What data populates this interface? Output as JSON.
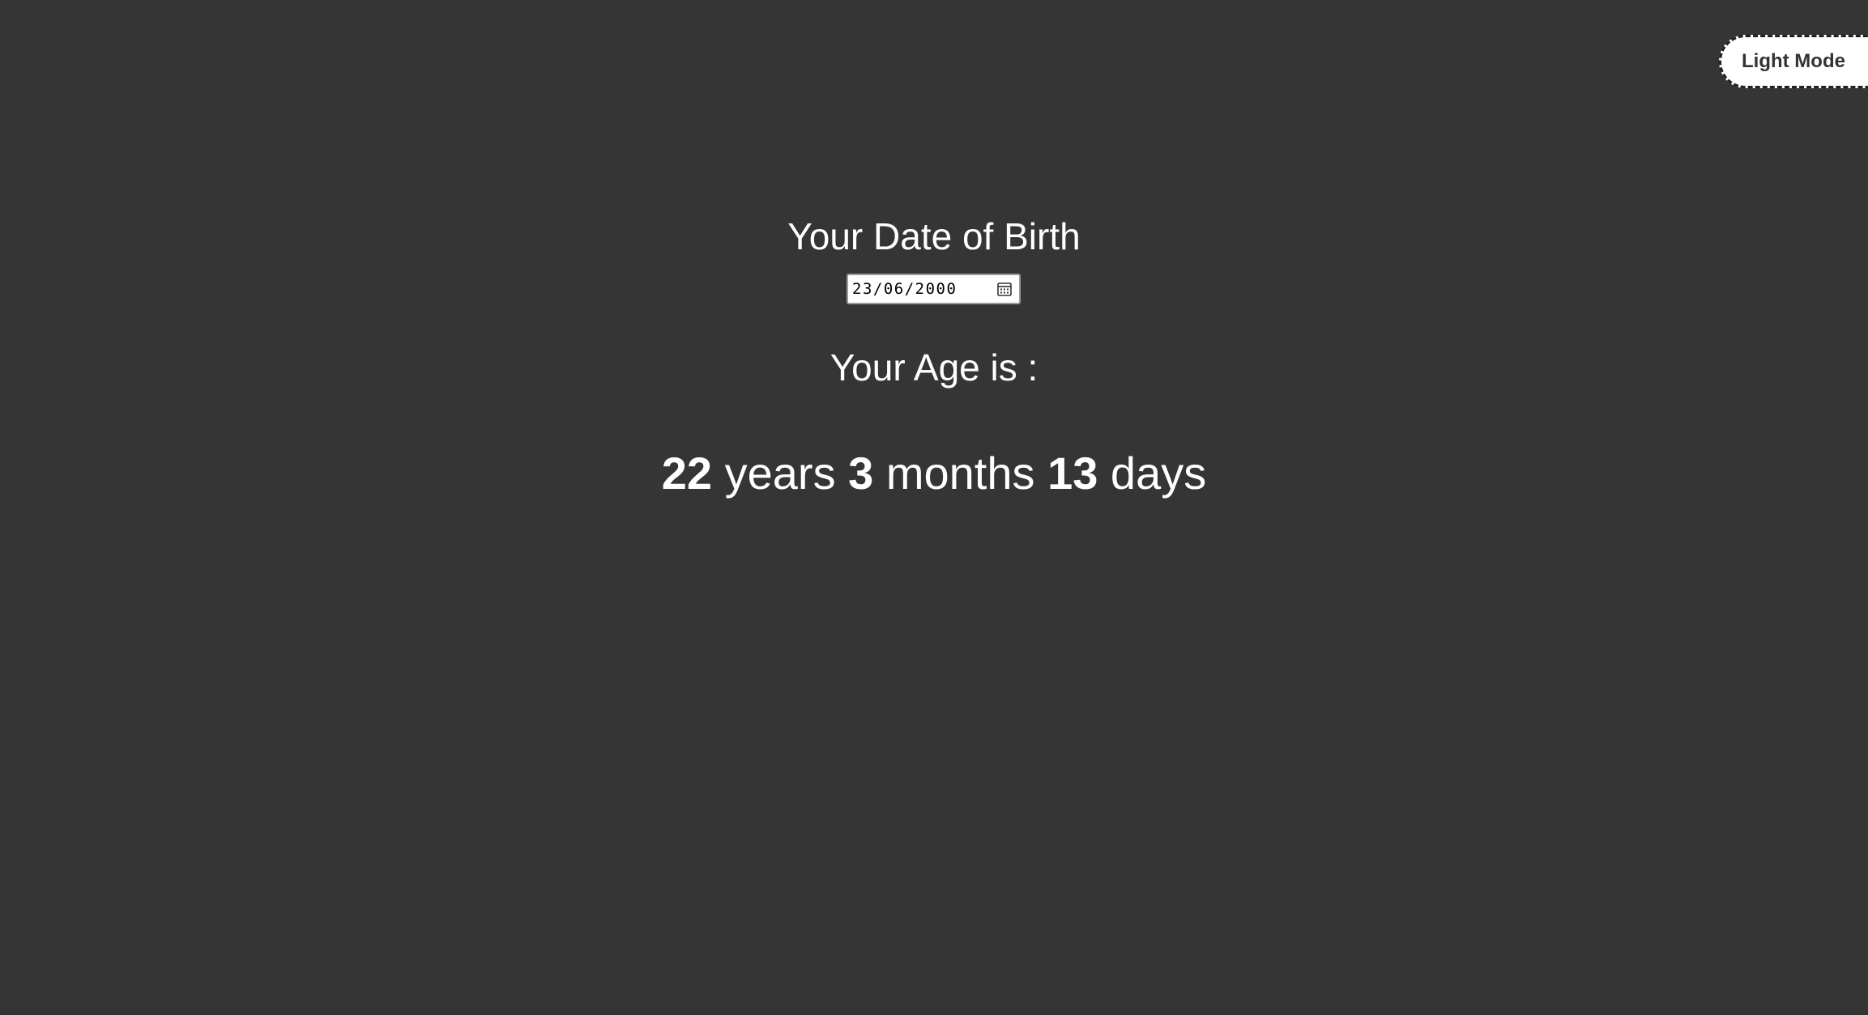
{
  "theme_toggle": {
    "label": "Light Mode"
  },
  "dob": {
    "heading": "Your Date of Birth",
    "value": "23/06/2000",
    "icon": "calendar-icon"
  },
  "age": {
    "heading": "Your Age is :",
    "years": "22",
    "years_unit": "years",
    "months": "3",
    "months_unit": "months",
    "days": "13",
    "days_unit": "days"
  },
  "colors": {
    "background": "#353535",
    "text": "#ffffff",
    "toggle_background": "#ffffff",
    "toggle_text": "#333333"
  }
}
